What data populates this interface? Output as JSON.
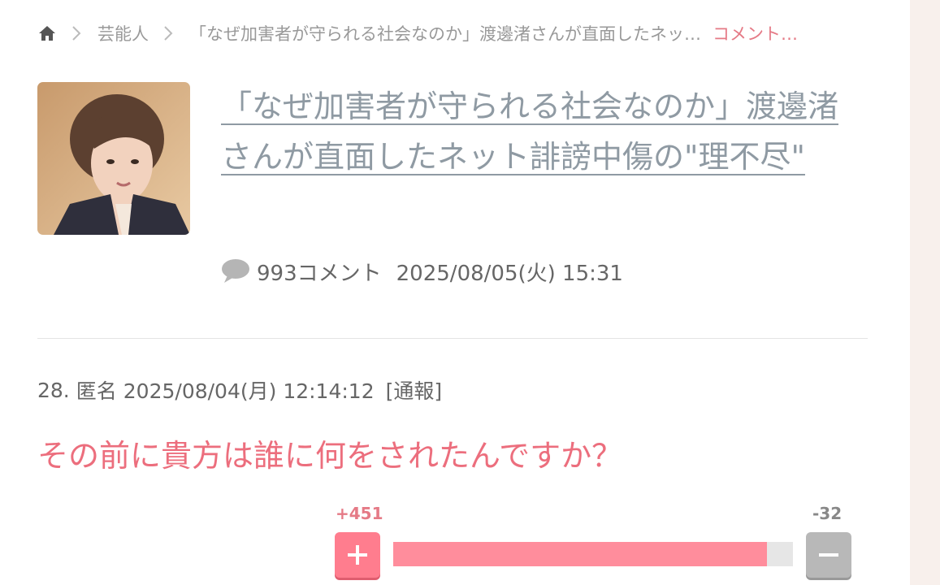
{
  "breadcrumb": {
    "category": "芸能人",
    "article": "「なぜ加害者が守られる社会なのか」渡邊渚さんが直面したネッ…",
    "current": "コメント…"
  },
  "article": {
    "title": "「なぜ加害者が守られる社会なのか」渡邊渚さんが直面したネット誹謗中傷の\"理不尽\"",
    "comment_count": "993コメント",
    "date": "2025/08/05(火) 15:31"
  },
  "comment": {
    "number": "28.",
    "author": "匿名",
    "datetime": "2025/08/04(月) 12:14:12",
    "report_label": "[通報]",
    "body": "その前に貴方は誰に何をされたんですか？",
    "plus_votes": "+451",
    "minus_votes": "-32",
    "plus_ratio": 0.934
  },
  "icons": {
    "home": "home-icon",
    "chevron": "chevron-right-icon",
    "comment": "speech-bubble-icon",
    "plus": "plus-icon",
    "minus": "minus-icon"
  },
  "colors": {
    "accent": "#ec6e7d",
    "plus_button": "#ff7d8e",
    "bar_fill": "#ff8d9c",
    "minus_button": "#b8b8b8",
    "title_link": "#8f9aa3"
  }
}
